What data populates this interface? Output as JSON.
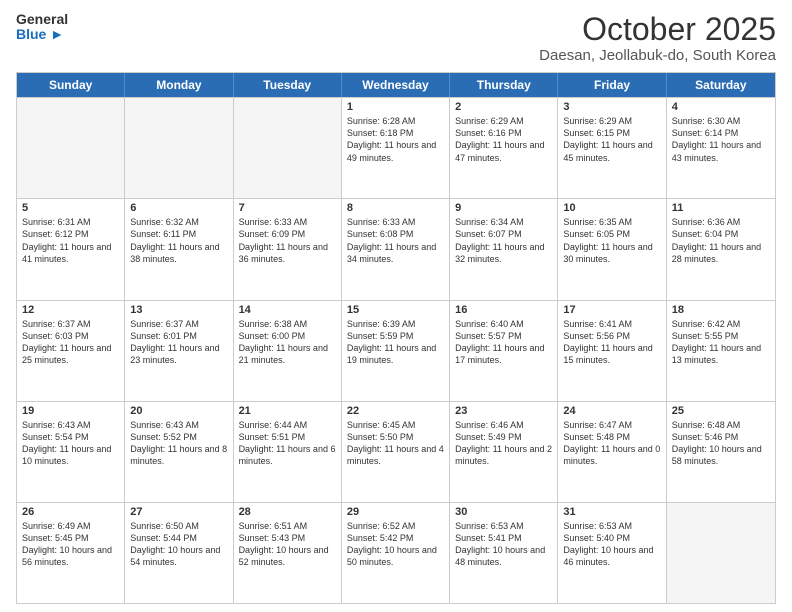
{
  "header": {
    "logo": {
      "general": "General",
      "blue": "Blue"
    },
    "title": "October 2025",
    "subtitle": "Daesan, Jeollabuk-do, South Korea"
  },
  "calendar": {
    "days": [
      "Sunday",
      "Monday",
      "Tuesday",
      "Wednesday",
      "Thursday",
      "Friday",
      "Saturday"
    ],
    "rows": [
      [
        {
          "day": "",
          "empty": true
        },
        {
          "day": "",
          "empty": true
        },
        {
          "day": "",
          "empty": true
        },
        {
          "day": "1",
          "sunrise": "Sunrise: 6:28 AM",
          "sunset": "Sunset: 6:18 PM",
          "daylight": "Daylight: 11 hours and 49 minutes."
        },
        {
          "day": "2",
          "sunrise": "Sunrise: 6:29 AM",
          "sunset": "Sunset: 6:16 PM",
          "daylight": "Daylight: 11 hours and 47 minutes."
        },
        {
          "day": "3",
          "sunrise": "Sunrise: 6:29 AM",
          "sunset": "Sunset: 6:15 PM",
          "daylight": "Daylight: 11 hours and 45 minutes."
        },
        {
          "day": "4",
          "sunrise": "Sunrise: 6:30 AM",
          "sunset": "Sunset: 6:14 PM",
          "daylight": "Daylight: 11 hours and 43 minutes."
        }
      ],
      [
        {
          "day": "5",
          "sunrise": "Sunrise: 6:31 AM",
          "sunset": "Sunset: 6:12 PM",
          "daylight": "Daylight: 11 hours and 41 minutes."
        },
        {
          "day": "6",
          "sunrise": "Sunrise: 6:32 AM",
          "sunset": "Sunset: 6:11 PM",
          "daylight": "Daylight: 11 hours and 38 minutes."
        },
        {
          "day": "7",
          "sunrise": "Sunrise: 6:33 AM",
          "sunset": "Sunset: 6:09 PM",
          "daylight": "Daylight: 11 hours and 36 minutes."
        },
        {
          "day": "8",
          "sunrise": "Sunrise: 6:33 AM",
          "sunset": "Sunset: 6:08 PM",
          "daylight": "Daylight: 11 hours and 34 minutes."
        },
        {
          "day": "9",
          "sunrise": "Sunrise: 6:34 AM",
          "sunset": "Sunset: 6:07 PM",
          "daylight": "Daylight: 11 hours and 32 minutes."
        },
        {
          "day": "10",
          "sunrise": "Sunrise: 6:35 AM",
          "sunset": "Sunset: 6:05 PM",
          "daylight": "Daylight: 11 hours and 30 minutes."
        },
        {
          "day": "11",
          "sunrise": "Sunrise: 6:36 AM",
          "sunset": "Sunset: 6:04 PM",
          "daylight": "Daylight: 11 hours and 28 minutes."
        }
      ],
      [
        {
          "day": "12",
          "sunrise": "Sunrise: 6:37 AM",
          "sunset": "Sunset: 6:03 PM",
          "daylight": "Daylight: 11 hours and 25 minutes."
        },
        {
          "day": "13",
          "sunrise": "Sunrise: 6:37 AM",
          "sunset": "Sunset: 6:01 PM",
          "daylight": "Daylight: 11 hours and 23 minutes."
        },
        {
          "day": "14",
          "sunrise": "Sunrise: 6:38 AM",
          "sunset": "Sunset: 6:00 PM",
          "daylight": "Daylight: 11 hours and 21 minutes."
        },
        {
          "day": "15",
          "sunrise": "Sunrise: 6:39 AM",
          "sunset": "Sunset: 5:59 PM",
          "daylight": "Daylight: 11 hours and 19 minutes."
        },
        {
          "day": "16",
          "sunrise": "Sunrise: 6:40 AM",
          "sunset": "Sunset: 5:57 PM",
          "daylight": "Daylight: 11 hours and 17 minutes."
        },
        {
          "day": "17",
          "sunrise": "Sunrise: 6:41 AM",
          "sunset": "Sunset: 5:56 PM",
          "daylight": "Daylight: 11 hours and 15 minutes."
        },
        {
          "day": "18",
          "sunrise": "Sunrise: 6:42 AM",
          "sunset": "Sunset: 5:55 PM",
          "daylight": "Daylight: 11 hours and 13 minutes."
        }
      ],
      [
        {
          "day": "19",
          "sunrise": "Sunrise: 6:43 AM",
          "sunset": "Sunset: 5:54 PM",
          "daylight": "Daylight: 11 hours and 10 minutes."
        },
        {
          "day": "20",
          "sunrise": "Sunrise: 6:43 AM",
          "sunset": "Sunset: 5:52 PM",
          "daylight": "Daylight: 11 hours and 8 minutes."
        },
        {
          "day": "21",
          "sunrise": "Sunrise: 6:44 AM",
          "sunset": "Sunset: 5:51 PM",
          "daylight": "Daylight: 11 hours and 6 minutes."
        },
        {
          "day": "22",
          "sunrise": "Sunrise: 6:45 AM",
          "sunset": "Sunset: 5:50 PM",
          "daylight": "Daylight: 11 hours and 4 minutes."
        },
        {
          "day": "23",
          "sunrise": "Sunrise: 6:46 AM",
          "sunset": "Sunset: 5:49 PM",
          "daylight": "Daylight: 11 hours and 2 minutes."
        },
        {
          "day": "24",
          "sunrise": "Sunrise: 6:47 AM",
          "sunset": "Sunset: 5:48 PM",
          "daylight": "Daylight: 11 hours and 0 minutes."
        },
        {
          "day": "25",
          "sunrise": "Sunrise: 6:48 AM",
          "sunset": "Sunset: 5:46 PM",
          "daylight": "Daylight: 10 hours and 58 minutes."
        }
      ],
      [
        {
          "day": "26",
          "sunrise": "Sunrise: 6:49 AM",
          "sunset": "Sunset: 5:45 PM",
          "daylight": "Daylight: 10 hours and 56 minutes."
        },
        {
          "day": "27",
          "sunrise": "Sunrise: 6:50 AM",
          "sunset": "Sunset: 5:44 PM",
          "daylight": "Daylight: 10 hours and 54 minutes."
        },
        {
          "day": "28",
          "sunrise": "Sunrise: 6:51 AM",
          "sunset": "Sunset: 5:43 PM",
          "daylight": "Daylight: 10 hours and 52 minutes."
        },
        {
          "day": "29",
          "sunrise": "Sunrise: 6:52 AM",
          "sunset": "Sunset: 5:42 PM",
          "daylight": "Daylight: 10 hours and 50 minutes."
        },
        {
          "day": "30",
          "sunrise": "Sunrise: 6:53 AM",
          "sunset": "Sunset: 5:41 PM",
          "daylight": "Daylight: 10 hours and 48 minutes."
        },
        {
          "day": "31",
          "sunrise": "Sunrise: 6:53 AM",
          "sunset": "Sunset: 5:40 PM",
          "daylight": "Daylight: 10 hours and 46 minutes."
        },
        {
          "day": "",
          "empty": true
        }
      ]
    ]
  }
}
